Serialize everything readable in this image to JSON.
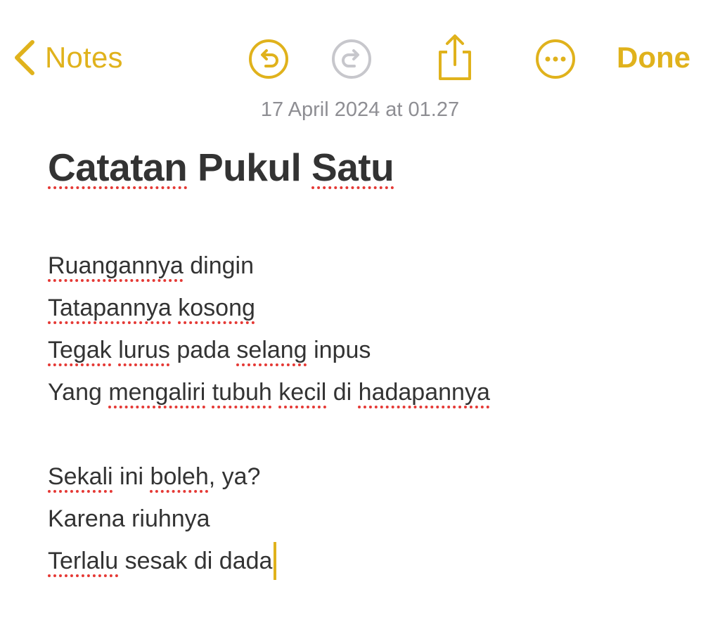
{
  "nav": {
    "back_label": "Notes",
    "done_label": "Done",
    "accent_color": "#E0B21C",
    "icons": [
      "chevron-left-icon",
      "undo-icon",
      "redo-icon",
      "share-icon",
      "more-icon"
    ]
  },
  "note": {
    "timestamp": "17 April 2024 at 01.27",
    "title": {
      "w1": "Catatan",
      "w2": " Pukul ",
      "w3": "Satu"
    },
    "stanza1": {
      "l1": {
        "a": "Ruangannya",
        "b": " dingin"
      },
      "l2": {
        "a": "Tatapannya",
        "b": " ",
        "c": "kosong"
      },
      "l3": {
        "a": "Tegak",
        "b": " ",
        "c": "lurus",
        "d": " pada ",
        "e": "selang",
        "f": " inpus"
      },
      "l4": {
        "a": "Yang ",
        "b": "mengaliri",
        "c": " ",
        "d": "tubuh",
        "e": " ",
        "f": "kecil",
        "g": " di ",
        "h": "hadapannya"
      }
    },
    "stanza2": {
      "l1": {
        "a": "Sekali",
        "b": " ini ",
        "c": "boleh",
        "d": ", ya?"
      },
      "l2": {
        "a": "Karena riuhnya"
      },
      "l3": {
        "a": "Terlalu",
        "b": " sesak di dada"
      }
    },
    "spellcheck_color": "#E53935"
  }
}
